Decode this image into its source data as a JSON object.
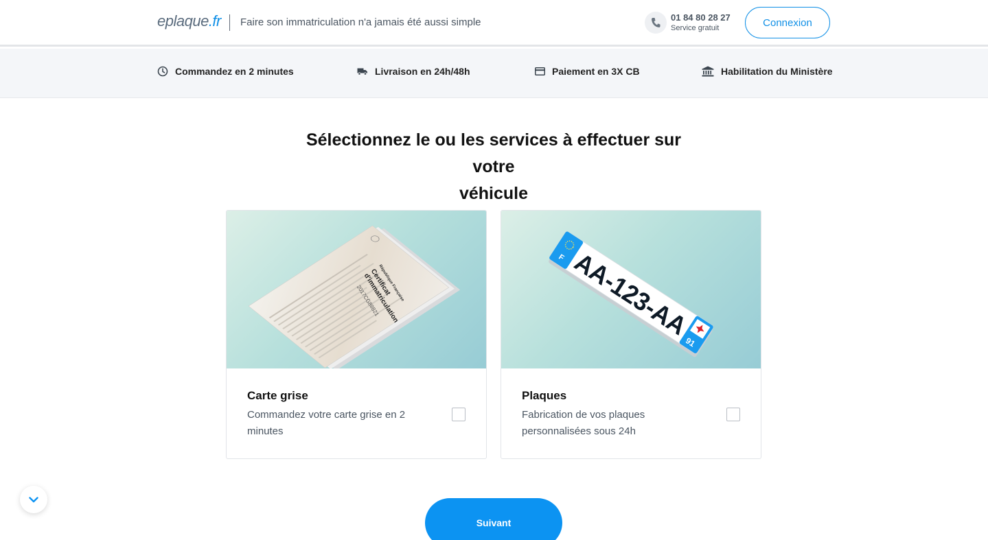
{
  "header": {
    "logo_part1": "eplaque",
    "logo_part2": ".fr",
    "tagline": "Faire son immatriculation n'a jamais été aussi simple",
    "phone_number": "01 84 80 28 27",
    "phone_subtitle": "Service gratuit",
    "login_label": "Connexion"
  },
  "features": [
    {
      "label": "Commandez en 2 minutes",
      "icon": "clock-icon"
    },
    {
      "label": "Livraison en 24h/48h",
      "icon": "truck-icon"
    },
    {
      "label": "Paiement en 3X CB",
      "icon": "credit-card-icon"
    },
    {
      "label": "Habilitation du Ministère",
      "icon": "bank-icon"
    }
  ],
  "main": {
    "title_line1": "Sélectionnez le ou les services à effectuer sur votre",
    "title_line2": "véhicule"
  },
  "cards": [
    {
      "title": "Carte grise",
      "description": "Commandez votre carte grise en 2 minutes",
      "checked": false,
      "image_text": {
        "republic": "République Française",
        "doc_line1": "Certificat",
        "doc_line2": "d'immatriculation",
        "doc_number": "2017CG88821"
      }
    },
    {
      "title": "Plaques",
      "description": "Fabrication de vos plaques personnalisées sous 24h",
      "checked": false,
      "image_text": {
        "plate": "AA-123-AA",
        "country": "F",
        "department": "91"
      }
    }
  ],
  "actions": {
    "next_label": "Suivant"
  },
  "colors": {
    "accent": "#0c93f2",
    "text_muted": "#4a5561"
  }
}
